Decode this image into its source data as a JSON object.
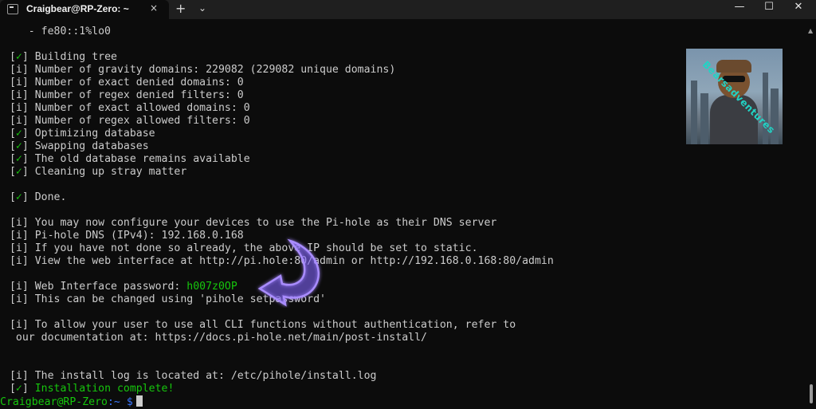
{
  "window": {
    "tab_title": "Craigbear@RP-Zero: ~",
    "tab_close": "×",
    "new_tab": "+",
    "tab_dropdown": "⌄",
    "min": "—",
    "max": "☐",
    "close": "✕"
  },
  "terminal": {
    "lines": [
      {
        "mark": "",
        "text": "    - fe80::1%lo0"
      },
      {
        "mark": "",
        "text": ""
      },
      {
        "mark": "✓",
        "text": "Building tree"
      },
      {
        "mark": "i",
        "text": "Number of gravity domains: 229082 (229082 unique domains)"
      },
      {
        "mark": "i",
        "text": "Number of exact denied domains: 0"
      },
      {
        "mark": "i",
        "text": "Number of regex denied filters: 0"
      },
      {
        "mark": "i",
        "text": "Number of exact allowed domains: 0"
      },
      {
        "mark": "i",
        "text": "Number of regex allowed filters: 0"
      },
      {
        "mark": "✓",
        "text": "Optimizing database"
      },
      {
        "mark": "✓",
        "text": "Swapping databases"
      },
      {
        "mark": "✓",
        "text": "The old database remains available"
      },
      {
        "mark": "✓",
        "text": "Cleaning up stray matter"
      },
      {
        "mark": "",
        "text": ""
      },
      {
        "mark": "✓",
        "text": "Done."
      },
      {
        "mark": "",
        "text": ""
      },
      {
        "mark": "i",
        "text": "You may now configure your devices to use the Pi-hole as their DNS server"
      },
      {
        "mark": "i",
        "text": "Pi-hole DNS (IPv4): 192.168.0.168"
      },
      {
        "mark": "i",
        "text": "If you have not done so already, the above IP should be set to static."
      },
      {
        "mark": "i",
        "text": "View the web interface at http://pi.hole:80/admin or http://192.168.0.168:80/admin"
      },
      {
        "mark": "",
        "text": ""
      },
      {
        "mark": "i",
        "text": "Web Interface password: ",
        "highlight": "h007z0OP"
      },
      {
        "mark": "i",
        "text": "This can be changed using 'pihole setpassword'"
      },
      {
        "mark": "",
        "text": ""
      },
      {
        "mark": "i",
        "text": "To allow your user to use all CLI functions without authentication, refer to"
      },
      {
        "mark": "",
        "text": "  our documentation at: https://docs.pi-hole.net/main/post-install/"
      },
      {
        "mark": "",
        "text": ""
      },
      {
        "mark": "",
        "text": ""
      },
      {
        "mark": "i",
        "text": "The install log is located at: /etc/pihole/install.log"
      },
      {
        "mark": "✓",
        "text": "Installation complete!",
        "all_green": true
      }
    ],
    "prompt": {
      "user": "Craigbear@RP-Zero",
      "path": ":~",
      "symbol": "$"
    }
  },
  "watermark": {
    "text": "Bearsadventures"
  },
  "colors": {
    "background": "#0c0c0c",
    "text": "#cccccc",
    "green": "#16c60c",
    "blue": "#3b78ff",
    "arrow": "#8a6cff"
  }
}
